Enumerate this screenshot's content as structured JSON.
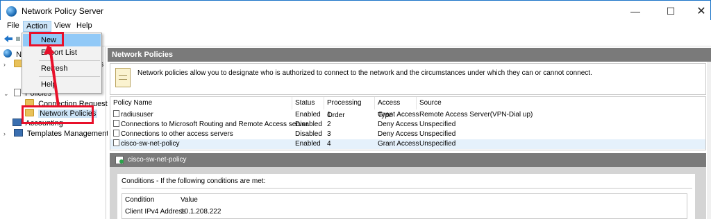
{
  "window": {
    "title": "Network Policy Server",
    "controls": {
      "minimize": "—",
      "maximize": "☐",
      "close": "✕"
    }
  },
  "menubar": {
    "file": "File",
    "action": "Action",
    "view": "View",
    "help": "Help"
  },
  "context_menu": {
    "items": [
      "New",
      "Export List",
      "Refresh",
      "Help"
    ]
  },
  "tree": {
    "items": [
      {
        "label": "N",
        "icon": "globe-icon"
      },
      {
        "label": "",
        "icon": "folder-icon",
        "peek": "rs"
      },
      {
        "label": "Policies",
        "icon": "doc-icon"
      },
      {
        "label": "Connection Request Po",
        "icon": "folder-icon"
      },
      {
        "label": "Network Policies",
        "icon": "folder-icon"
      },
      {
        "label": "Accounting",
        "icon": "monitor-icon"
      },
      {
        "label": "Templates Management",
        "icon": "monitor-icon"
      }
    ],
    "peek_r": "r"
  },
  "pane": {
    "header": "Network Policies",
    "info": "Network policies allow you to designate who is authorized to connect to the network and the circumstances under which they can or cannot connect."
  },
  "policy_table": {
    "columns": [
      "Policy Name",
      "Status",
      "Processing Order",
      "Access Type",
      "Source"
    ],
    "rows": [
      [
        "radiususer",
        "Enabled",
        "1",
        "Grant Access",
        "Remote Access Server(VPN-Dial up)"
      ],
      [
        "Connections to Microsoft Routing and Remote Access server",
        "Disabled",
        "2",
        "Deny Access",
        "Unspecified"
      ],
      [
        "Connections to other access servers",
        "Disabled",
        "3",
        "Deny Access",
        "Unspecified"
      ],
      [
        "cisco-sw-net-policy",
        "Enabled",
        "4",
        "Grant Access",
        "Unspecified"
      ]
    ]
  },
  "detail": {
    "title": "cisco-sw-net-policy",
    "conditions_title": "Conditions - If the following conditions are met:",
    "columns": [
      "Condition",
      "Value"
    ],
    "rows": [
      [
        "Client IPv4 Address",
        "10.1.208.222"
      ]
    ]
  },
  "colors": {
    "highlight_red": "#e8102a",
    "selection_blue": "#91c9f7",
    "header_gray": "#7a7a7a"
  }
}
